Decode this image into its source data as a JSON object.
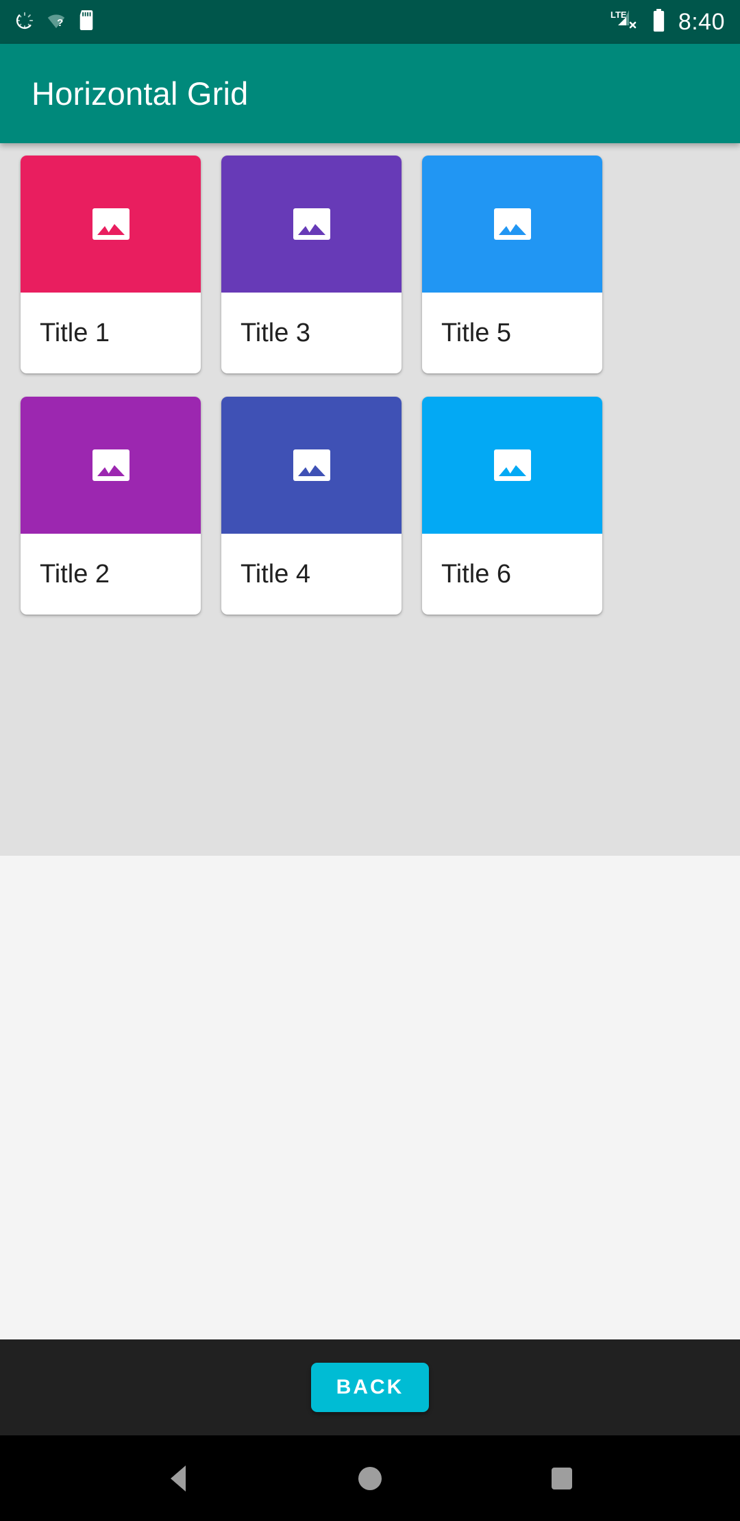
{
  "status_bar": {
    "icons": [
      "sync-spinner-icon",
      "wifi-unknown-icon",
      "sd-card-icon"
    ],
    "network_label": "LTE",
    "network_state": "no-service",
    "battery": "battery-full-icon",
    "time": "8:40"
  },
  "app_bar": {
    "title": "Horizontal Grid"
  },
  "grid": {
    "scroll_direction": "horizontal",
    "rows": 2,
    "cards": [
      {
        "title": "Title 1",
        "color": "#E91E5F",
        "icon": "image-placeholder-icon"
      },
      {
        "title": "Title 2",
        "color": "#9C27B0",
        "icon": "image-placeholder-icon"
      },
      {
        "title": "Title 3",
        "color": "#673AB7",
        "icon": "image-placeholder-icon"
      },
      {
        "title": "Title 4",
        "color": "#3F51B5",
        "icon": "image-placeholder-icon"
      },
      {
        "title": "Title 5",
        "color": "#2196F3",
        "icon": "image-placeholder-icon"
      },
      {
        "title": "Title 6",
        "color": "#03A9F4",
        "icon": "image-placeholder-icon"
      }
    ]
  },
  "footer": {
    "back_label": "BACK",
    "back_color": "#00BCD4",
    "background": "#212121"
  },
  "nav_bar": {
    "back": "nav-back-icon",
    "home": "nav-home-icon",
    "recents": "nav-recents-icon"
  },
  "theme": {
    "status_bar_bg": "#00564B",
    "app_bar_bg": "#00897B",
    "grid_bg": "#E0E0E0",
    "page_bg": "#F4F4F4",
    "card_bg": "#FFFFFF",
    "title_text": "#202020"
  }
}
